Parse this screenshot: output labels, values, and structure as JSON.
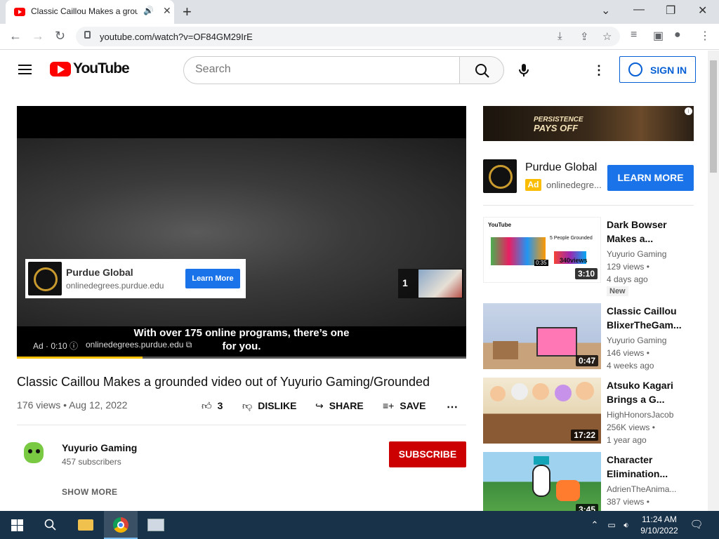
{
  "browser": {
    "tab_title": "Classic Caillou Makes a grounded video out of Yuyurio Gaming/Grounded",
    "url": "youtube.com/watch?v=OF84GM29IrE",
    "new_tab": "+",
    "minimize": "—",
    "restore": "❐",
    "close": "✕"
  },
  "youtube": {
    "logo_text": "YouTube",
    "search_placeholder": "Search",
    "sign_in": "SIGN IN"
  },
  "player": {
    "ad_card": {
      "name": "Purdue Global",
      "domain": "onlinedegrees.purdue.edu",
      "button": "Learn More"
    },
    "skip_count": "1",
    "caption": "With over 175 online programs, there’s one for you.",
    "ad_info": "Ad · 0:10 ⓘ",
    "ad_domain": "onlinedegrees.purdue.edu ⧉",
    "progress_fraction": 0.28
  },
  "video": {
    "title": "Classic Caillou Makes a grounded video out of Yuyurio Gaming/Grounded",
    "meta": "176 views • Aug 12, 2022",
    "likes": "3",
    "dislike": "DISLIKE",
    "share": "SHARE",
    "save": "SAVE",
    "channel": "Yuyurio Gaming",
    "subscribers": "457 subscribers",
    "subscribe": "SUBSCRIBE",
    "show_more": "SHOW MORE"
  },
  "sidebar_ad": {
    "banner_line1": "PERSISTENCE",
    "banner_line2": "PAYS OFF",
    "name": "Purdue Global",
    "badge": "Ad",
    "domain": "onlinedegre...",
    "button": "LEARN MORE"
  },
  "recommendations": [
    {
      "title": "Dark Bowser Makes a...",
      "channel": "Yuyurio Gaming",
      "views": "129 views •",
      "age": "4 days ago",
      "badge": "New",
      "duration": "3:10"
    },
    {
      "title": "Classic Caillou BlixerTheGam...",
      "channel": "Yuyurio Gaming",
      "views": "146 views •",
      "age": "4 weeks ago",
      "duration": "0:47"
    },
    {
      "title": "Atsuko Kagari Brings a G...",
      "channel": "HighHonorsJacob",
      "views": "256K views •",
      "age": "1 year ago",
      "duration": "17:22"
    },
    {
      "title": "Character Elimination...",
      "channel": "AdrienTheAnima...",
      "views": "387 views •",
      "age": "",
      "duration": "3:45"
    }
  ],
  "rec0_thumb": {
    "youtube_label": "YouTube",
    "text": "5 People Grounded",
    "views": "340views"
  },
  "taskbar": {
    "time": "11:24 AM",
    "date": "9/10/2022"
  },
  "colors": {
    "youtube_red": "#ff0000",
    "subscribe_red": "#cc0000",
    "link_blue": "#065fd4",
    "ad_blue": "#1a73e8",
    "taskbar": "#18324a"
  }
}
